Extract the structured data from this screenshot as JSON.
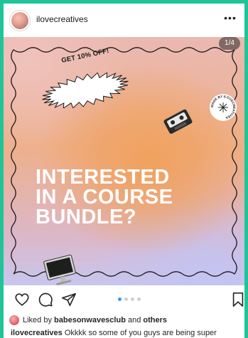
{
  "header": {
    "username": "ilovecreatives",
    "more_icon": "more-horizontal-icon",
    "more_glyph": "•••"
  },
  "post": {
    "counter": "1/4",
    "sticker_text": "GET 10% OFF!",
    "seal_text": "MADE BY ILOVECREATIVES",
    "headline": [
      "INTERESTED",
      "IN A COURSE",
      "BUNDLE?"
    ],
    "colors": {
      "headline": "#ffffff",
      "gradient_warm": "#f0a15d",
      "gradient_cool": "#c9c6ee"
    },
    "carousel": {
      "total": 4,
      "active_index": 0
    }
  },
  "actions": {
    "like_icon": "heart-icon",
    "comment_icon": "comment-icon",
    "share_icon": "paper-plane-icon",
    "save_icon": "bookmark-icon"
  },
  "likes": {
    "prefix": "Liked by",
    "user": "babesonwavesclub",
    "connector": "and",
    "others": "others"
  },
  "caption": {
    "username": "ilovecreatives",
    "text": "Okkkk so some of you guys are being super"
  },
  "accent_color": "#3897f0",
  "frame_color": "#1fc597"
}
